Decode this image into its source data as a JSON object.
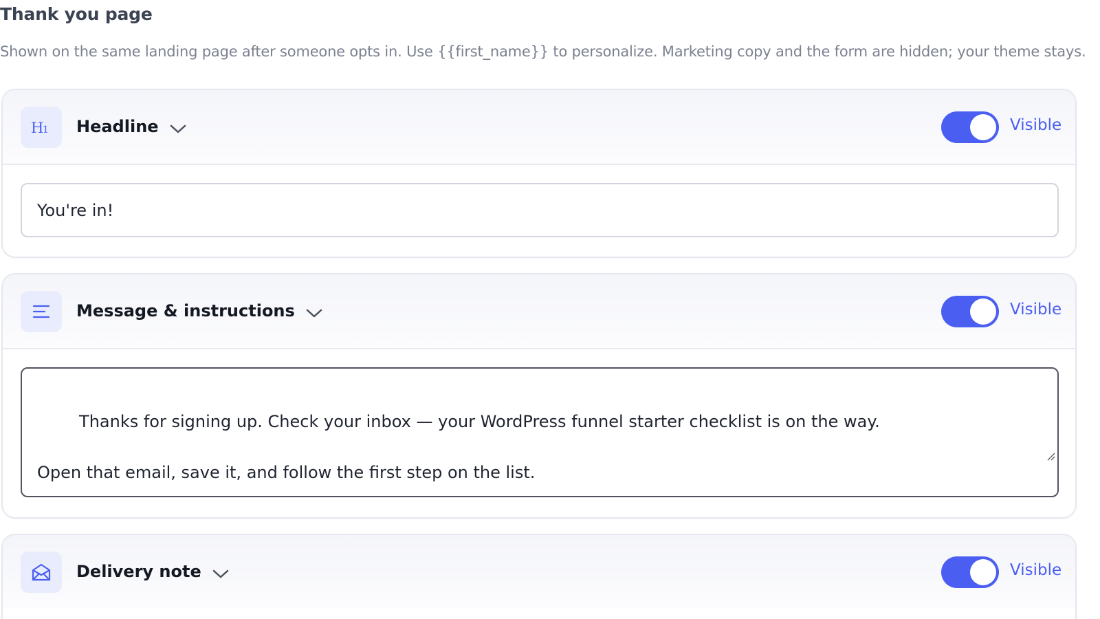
{
  "page": {
    "title": "Thank you page",
    "description": "Shown on the same landing page after someone opts in. Use {{first_name}} to personalize. Marketing copy and the form are hidden; your theme stays."
  },
  "theme": {
    "accent": "#4a5ff1",
    "icon_bg": "#e9ecfc"
  },
  "sections": [
    {
      "icon": "heading-h1-icon",
      "label": "Headline",
      "visible": true,
      "visibility_label": "Visible",
      "value": "You're in!"
    },
    {
      "icon": "align-left-lines-icon",
      "label": "Message & instructions",
      "visible": true,
      "visibility_label": "Visible",
      "value": "Thanks for signing up. Check your inbox — your WordPress funnel starter checklist is on the way.\n\nOpen that email, save it, and follow the first step on the list."
    },
    {
      "icon": "envelope-open-icon",
      "label": "Delivery note",
      "visible": true,
      "visibility_label": "Visible"
    }
  ]
}
